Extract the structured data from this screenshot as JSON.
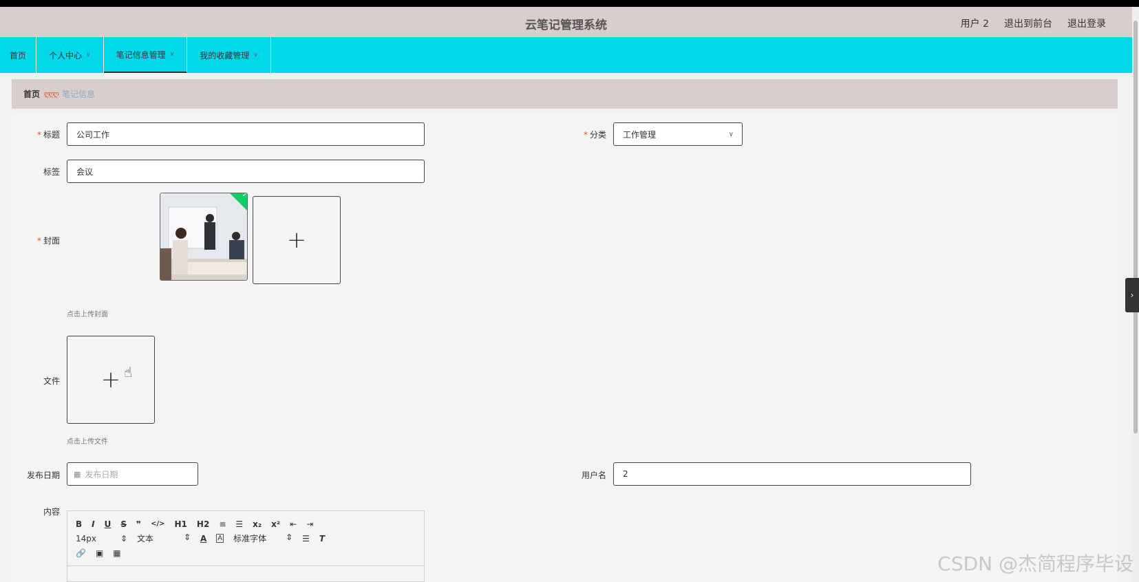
{
  "header": {
    "title": "云笔记管理系统",
    "user": "用户 2",
    "to_front": "退出到前台",
    "logout": "退出登录"
  },
  "nav": {
    "items": [
      {
        "label": "首页",
        "has_dropdown": false
      },
      {
        "label": "个人中心",
        "has_dropdown": true
      },
      {
        "label": "笔记信息管理",
        "has_dropdown": true,
        "active": true
      },
      {
        "label": "我的收藏管理",
        "has_dropdown": true
      }
    ]
  },
  "breadcrumb": {
    "home": "首页",
    "separator": "ღღღ",
    "current": "笔记信息"
  },
  "form": {
    "title_label": "标题",
    "title_value": "公司工作",
    "category_label": "分类",
    "category_value": "工作管理",
    "tag_label": "标签",
    "tag_value": "会议",
    "cover_label": "封面",
    "cover_hint": "点击上传封面",
    "file_label": "文件",
    "file_hint": "点击上传文件",
    "date_label": "发布日期",
    "date_placeholder": "发布日期",
    "username_label": "用户名",
    "username_value": "2",
    "content_label": "内容",
    "required_mark": "*",
    "upload_plus": "+"
  },
  "editor": {
    "row1": [
      "B",
      "I",
      "U",
      "S",
      "❞",
      "</>",
      "H1",
      "H2",
      "≡",
      "☰",
      "x₂",
      "x²",
      "⇤",
      "⇥"
    ],
    "font_size": "14px",
    "paragraph": "文本",
    "font_family": "标准字体",
    "row3": [
      "🔗",
      "▣",
      "▦"
    ]
  },
  "watermark": "CSDN @杰简程序毕设",
  "colors": {
    "nav_bg": "#00d7ea",
    "header_bg": "#d8cfcd",
    "required": "#e74c3c",
    "success": "#13ce66"
  }
}
